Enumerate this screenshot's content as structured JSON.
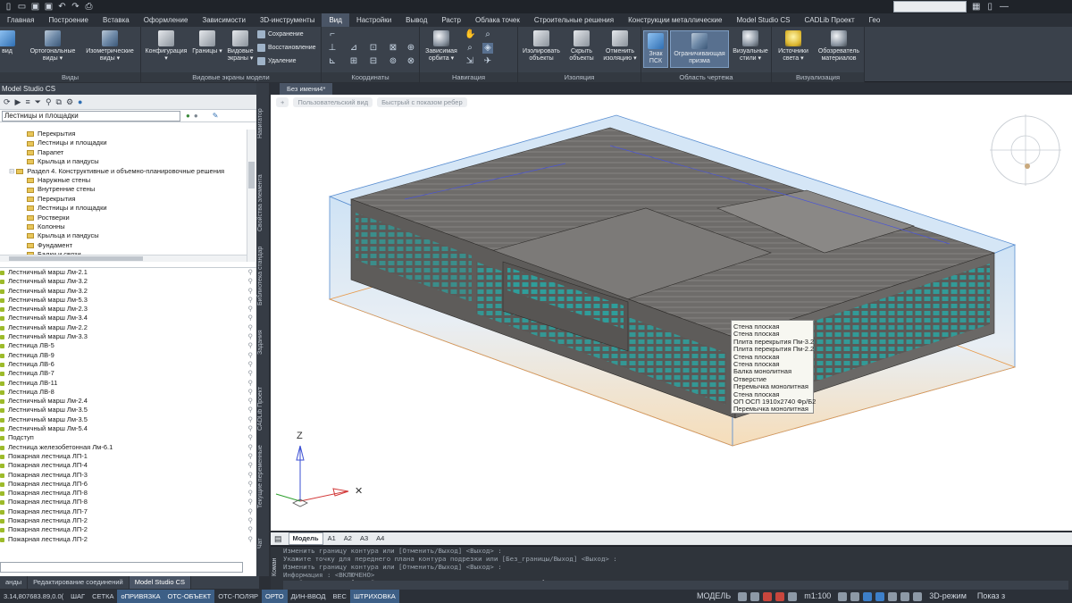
{
  "ribbon": {
    "tabs": [
      "Главная",
      "Построение",
      "Вставка",
      "Оформление",
      "Зависимости",
      "3D-инструменты",
      "Вид",
      "Настройки",
      "Вывод",
      "Растр",
      "Облака точек",
      "Строительные решения",
      "Конструкции металлические",
      "Model Studio CS",
      "CADLib Проект",
      "Гео"
    ],
    "active_tab": "Вид",
    "groups": {
      "views": {
        "title": "Виды",
        "btn_named": "Именованные виды",
        "btn_ortho": "Ортогональные виды ▾",
        "btn_iso": "Изометрические виды ▾"
      },
      "viewports": {
        "title": "Видовые экраны модели",
        "config": "Конфигурация ▾",
        "borders": "Границы ▾",
        "vp": "Видовые экраны ▾",
        "save": "Сохранение",
        "restore": "Восстановление",
        "delete": "Удаление"
      },
      "coords": {
        "title": "Координаты"
      },
      "nav": {
        "title": "Навигация",
        "orbit": "Зависимая орбита ▾"
      },
      "isolation": {
        "title": "Изоляция",
        "isolate": "Изолировать объекты",
        "hide": "Скрыть объекты",
        "cancel": "Отменить изоляцию ▾"
      },
      "area": {
        "title": "Область чертежа",
        "ucs": "Знак ПСК",
        "prism": "Ограничивающая призма",
        "styles": "Визуальные стили ▾"
      },
      "vis": {
        "title": "Визуализация",
        "lights": "Источники света ▾",
        "materials": "Обозреватель материалов"
      }
    }
  },
  "left": {
    "title": "Model Studio CS",
    "combo": "Лестницы и площадки",
    "tree": [
      {
        "label": "Перекрытия",
        "indent": 2
      },
      {
        "label": "Лестницы и площадки",
        "indent": 2
      },
      {
        "label": "Парапет",
        "indent": 2
      },
      {
        "label": "Крыльца и пандусы",
        "indent": 2
      },
      {
        "label": "Раздел 4. Конструктивные и объемно-планировочные решения",
        "indent": 1
      },
      {
        "label": "Наружные стены",
        "indent": 2
      },
      {
        "label": "Внутренние стены",
        "indent": 2
      },
      {
        "label": "Перекрытия",
        "indent": 2
      },
      {
        "label": "Лестницы и площадки",
        "indent": 2
      },
      {
        "label": "Ростверки",
        "indent": 2
      },
      {
        "label": "Колонны",
        "indent": 2
      },
      {
        "label": "Крыльца и пандусы",
        "indent": 2
      },
      {
        "label": "Фундамент",
        "indent": 2
      },
      {
        "label": "Балки и связи",
        "indent": 2
      }
    ],
    "list": [
      "Лестничный марш Лм-2.1",
      "Лестничный марш Лм-3.2",
      "Лестничный марш Лм-3.2",
      "Лестничный марш Лм-5.3",
      "Лестничный марш Лм-2.3",
      "Лестничный марш Лм-3.4",
      "Лестничный марш Лм-2.2",
      "Лестничный марш Лм-3.3",
      "Лестница ЛВ-5",
      "Лестница ЛВ-9",
      "Лестница ЛВ-6",
      "Лестница ЛВ-7",
      "Лестница ЛВ-11",
      "Лестница ЛВ-8",
      "Лестничный марш Лм-2.4",
      "Лестничный марш Лм-3.5",
      "Лестничный марш Лм-3.5",
      "Лестничный марш Лм-5.4",
      "Подступ",
      "Лестница железобетонная Лм-6.1",
      "Пожарная лестница ЛП-1",
      "Пожарная лестница ЛП-4",
      "Пожарная лестница ЛП-3",
      "Пожарная лестница ЛП-6",
      "Пожарная лестница ЛП-8",
      "Пожарная лестница ЛП-8",
      "Пожарная лестница ЛП-7",
      "Пожарная лестница ЛП-2",
      "Пожарная лестница ЛП-2",
      "Пожарная лестница ЛП-2"
    ],
    "bottom_tabs": [
      "анды",
      "Редактирование соединений",
      "Model Studio CS"
    ],
    "active_bottom_tab": "Model Studio CS"
  },
  "side_tabs": [
    "Навигатор",
    "Свойства элемента",
    "Библиотека стандар",
    "Задания",
    "CADLib Проект",
    "Текущие переменные",
    "Чат"
  ],
  "viewport": {
    "doc_tab": "Без имени4*",
    "chip_plus": "+",
    "chip_view": "Пользовательский вид",
    "chip_style": "Быстрый с показом ребер",
    "axis_z": "Z",
    "tooltip": [
      "Стена плоская",
      "Стена плоская",
      "Плита перекрытия Пм-3.2",
      "Плита перекрытия Пм-2.2",
      "Стена плоская",
      "Стена плоская",
      "Балка монолитная",
      "Отверстие",
      "Перемычка монолитная",
      "Стена плоская",
      "ОП ОСП 1910х2740 Фр/Б2",
      "Перемычка монолитная"
    ]
  },
  "model_tabs": [
    "Модель",
    "A1",
    "A2",
    "A3",
    "A4"
  ],
  "active_model_tab": "Модель",
  "command": {
    "lines": [
      "Изменить границу контура или [Отменить/Выход] <Выход> :",
      "Укажите точку для переднего плана контура подрезки или [Без_границы/Выход] <Выход> :",
      "Изменить границу контура или [Отменить/Выход] <Выход> :",
      "Информация : <ВКЛЮЧЕНО>",
      "Задайте параметр [Новый/Удалить/Изменить/вКлючить/вЫключить/Выход] <Выход> :"
    ],
    "side_label": "Коман"
  },
  "status": {
    "coords": "3.14,807683.89,0.0(",
    "toggles": [
      {
        "label": "ШАГ",
        "on": false
      },
      {
        "label": "СЕТКА",
        "on": false
      },
      {
        "label": "оПРИВЯЗКА",
        "on": true
      },
      {
        "label": "ОТС-ОБЪЕКТ",
        "on": true
      },
      {
        "label": "ОТС-ПОЛЯР",
        "on": false
      },
      {
        "label": "ОРТО",
        "on": true
      },
      {
        "label": "ДИН-ВВОД",
        "on": false
      },
      {
        "label": "ВЕС",
        "on": false
      },
      {
        "label": "ШТРИХОВКА",
        "on": true
      }
    ],
    "model": "МОДЕЛЬ",
    "scale": "m1:100",
    "mode": "3D-режим",
    "show": "Показ з"
  },
  "colors": {
    "prism_top": "#cfe3f5",
    "prism_bottom": "#f6ddb9",
    "building": "#5e5c5a",
    "window": "#2f9d9a",
    "accent_blue": "#3d5f86"
  }
}
